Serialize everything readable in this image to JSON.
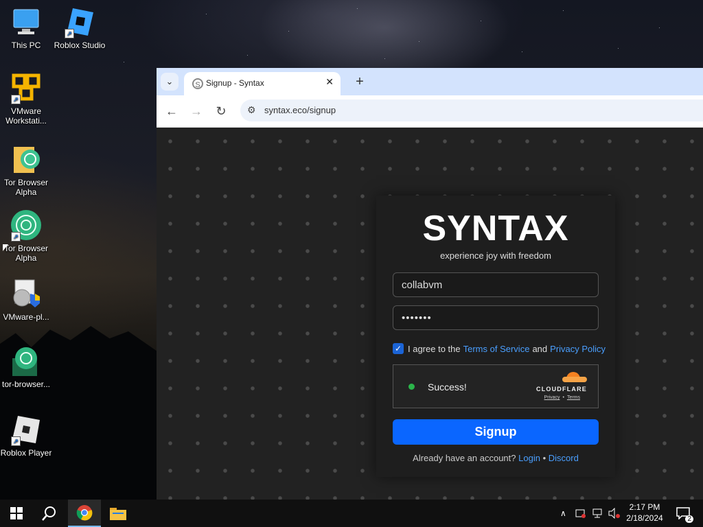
{
  "desktop": {
    "icons": [
      {
        "label": "This PC",
        "icon": "monitor-icon"
      },
      {
        "label": "Roblox Studio",
        "icon": "roblox-studio-icon"
      },
      {
        "label": "VMware Workstati...",
        "icon": "vmware-icon"
      },
      {
        "label": "Tor Browser Alpha",
        "icon": "tor-folder-icon"
      },
      {
        "label": "Tor Browser Alpha",
        "icon": "tor-browser-icon"
      },
      {
        "label": "VMware-pl...",
        "icon": "installer-icon"
      },
      {
        "label": "tor-browser...",
        "icon": "tor-installer-icon"
      },
      {
        "label": "Roblox Player",
        "icon": "roblox-player-icon"
      }
    ]
  },
  "browser": {
    "tab_title": "Signup - Syntax",
    "tab_close": "✕",
    "new_tab": "+",
    "url": "syntax.eco/signup"
  },
  "page": {
    "logo": "SYNTAX",
    "tagline": "experience joy with freedom",
    "username_value": "collabvm",
    "password_value": "•••••••",
    "agree_prefix": "I agree to the",
    "terms_link": "Terms of Service",
    "agree_and": "and",
    "privacy_link": "Privacy Policy",
    "captcha_status": "Success!",
    "captcha_brand": "CLOUDFLARE",
    "captcha_privacy": "Privacy",
    "captcha_sep": "•",
    "captcha_terms": "Terms",
    "signup_label": "Signup",
    "already_text": "Already have an account?",
    "login_link": "Login",
    "dot_sep": "•",
    "discord_link": "Discord"
  },
  "taskbar": {
    "time": "2:17 PM",
    "date": "2/18/2024",
    "notification_count": "2"
  }
}
